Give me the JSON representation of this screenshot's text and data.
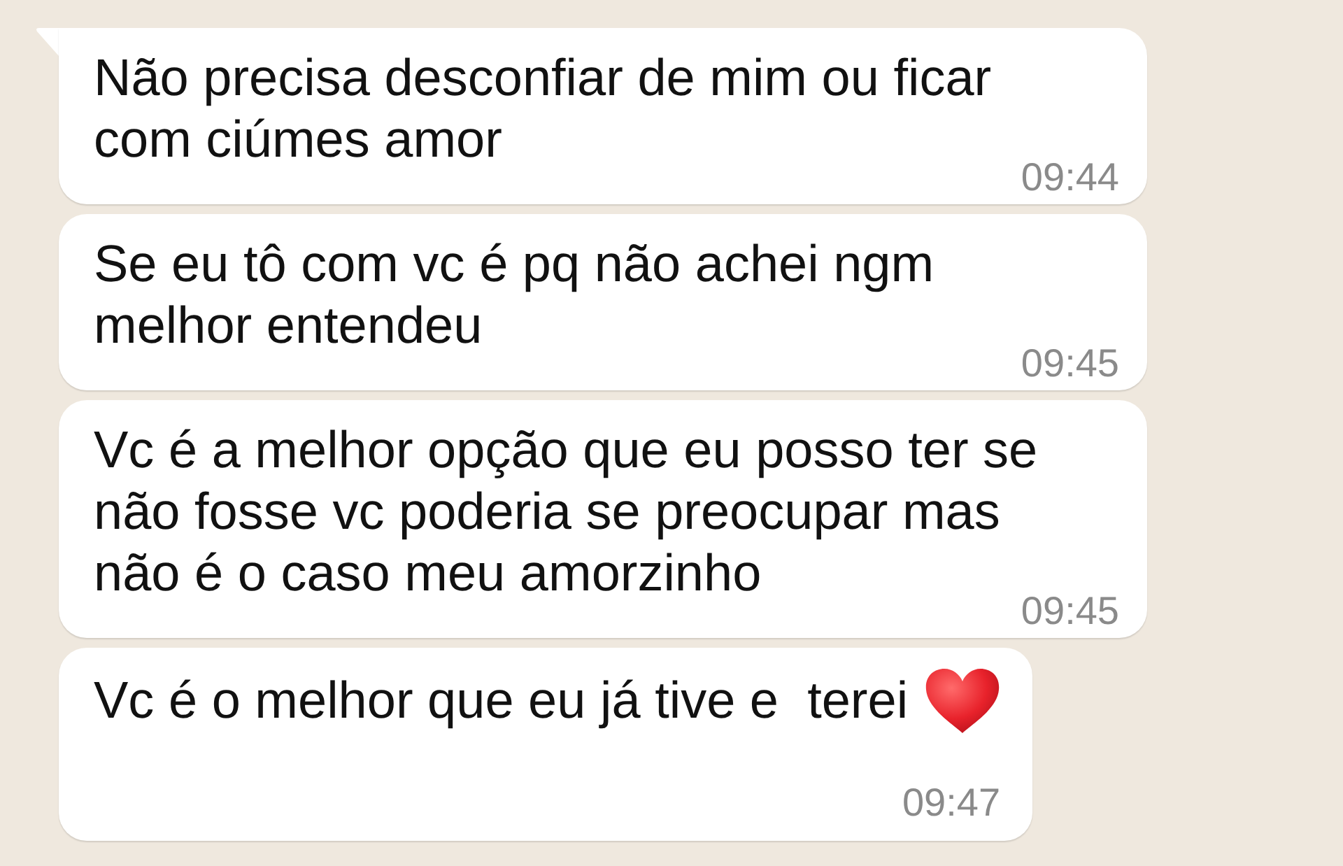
{
  "messages": [
    {
      "text": "Não precisa desconfiar de mim ou ficar\ncom ciúmes amor",
      "time": "09:44",
      "tail": true,
      "kind": "text"
    },
    {
      "text": "Se eu tô com vc é pq não achei ngm\nmelhor entendeu",
      "time": "09:45",
      "tail": false,
      "kind": "text"
    },
    {
      "text": "Vc é a melhor opção que eu posso ter se\nnão fosse vc poderia se preocupar mas\nnão é o caso meu amorzinho",
      "time": "09:45",
      "tail": false,
      "kind": "text"
    },
    {
      "text": "Vc é o melhor que eu já tive e  terei",
      "time": "09:47",
      "tail": false,
      "kind": "text_heart"
    }
  ]
}
